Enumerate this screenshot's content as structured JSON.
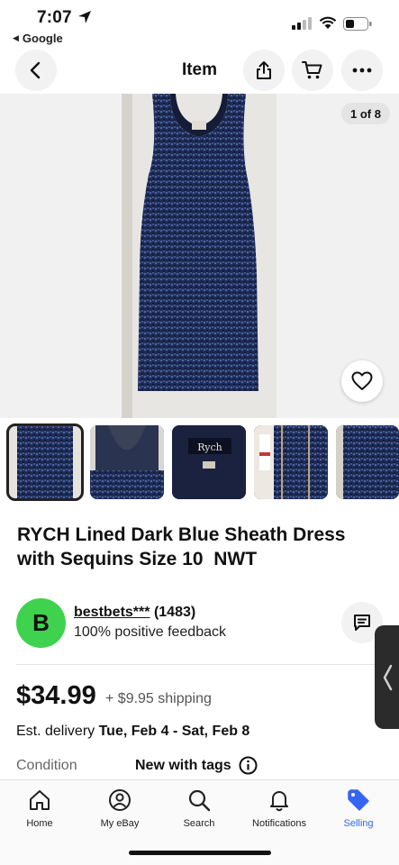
{
  "status_bar": {
    "time": "7:07",
    "back_app": "Google"
  },
  "header": {
    "title": "Item"
  },
  "gallery": {
    "counter": "1 of 8",
    "thumb_label_text": "Rych"
  },
  "listing": {
    "title": "RYCH Lined Dark Blue Sheath Dress with Sequins Size 10  NWT",
    "seller_name": "bestbets***",
    "seller_score": "(1483)",
    "seller_feedback": "100% positive feedback",
    "seller_initial": "B",
    "price": "$34.99",
    "shipping": "+ $9.95 shipping",
    "delivery_prefix": "Est. delivery",
    "delivery_dates": "Tue, Feb 4 - Sat, Feb 8",
    "condition_label": "Condition",
    "condition_value": "New with tags"
  },
  "bottom_nav": [
    {
      "label": "Home",
      "icon": "home-icon"
    },
    {
      "label": "My eBay",
      "icon": "person-icon"
    },
    {
      "label": "Search",
      "icon": "search-icon"
    },
    {
      "label": "Notifications",
      "icon": "bell-icon"
    },
    {
      "label": "Selling",
      "icon": "tag-icon"
    }
  ],
  "colors": {
    "accent": "#3665f3",
    "seller_avatar": "#3fd24e",
    "dress": "#1e2a4e"
  }
}
